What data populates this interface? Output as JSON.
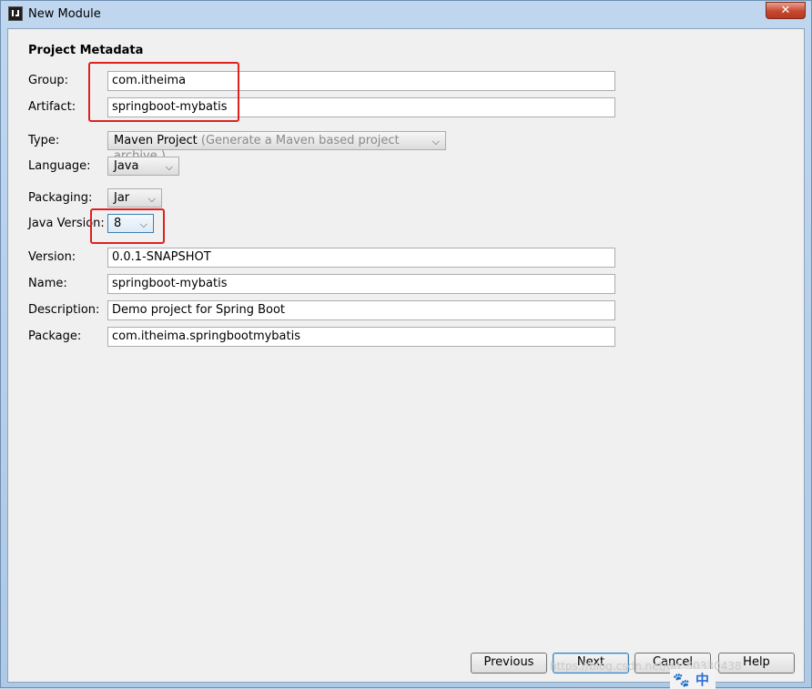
{
  "window": {
    "title": "New Module",
    "close_glyph": "✕"
  },
  "metadata": {
    "section_title": "Project Metadata",
    "group": {
      "label": "Group:",
      "value": "com.itheima"
    },
    "artifact": {
      "label": "Artifact:",
      "value": "springboot-mybatis"
    },
    "type": {
      "label": "Type:",
      "value": "Maven Project",
      "hint": "(Generate a Maven based project archive.)"
    },
    "language": {
      "label": "Language:",
      "value": "Java"
    },
    "packaging": {
      "label": "Packaging:",
      "value": "Jar"
    },
    "java_version": {
      "label": "Java Version:",
      "value": "8"
    },
    "version": {
      "label": "Version:",
      "value": "0.0.1-SNAPSHOT"
    },
    "name": {
      "label": "Name:",
      "value": "springboot-mybatis"
    },
    "description": {
      "label": "Description:",
      "value": "Demo project for Spring Boot"
    },
    "package": {
      "label": "Package:",
      "value": "com.itheima.springbootmybatis"
    }
  },
  "buttons": {
    "previous": "Previous",
    "next": "Next",
    "cancel": "Cancel",
    "help": "Help"
  },
  "overlay": {
    "watermark": "https://blog.csdn.net/qq_50330438",
    "ime_char": "中"
  },
  "colors": {
    "highlight": "#e02020",
    "accent": "#3c7fb1"
  },
  "icons": {
    "app": "intellij-icon",
    "dropdown": "chevron-down-icon",
    "ime": "paw-icon"
  }
}
